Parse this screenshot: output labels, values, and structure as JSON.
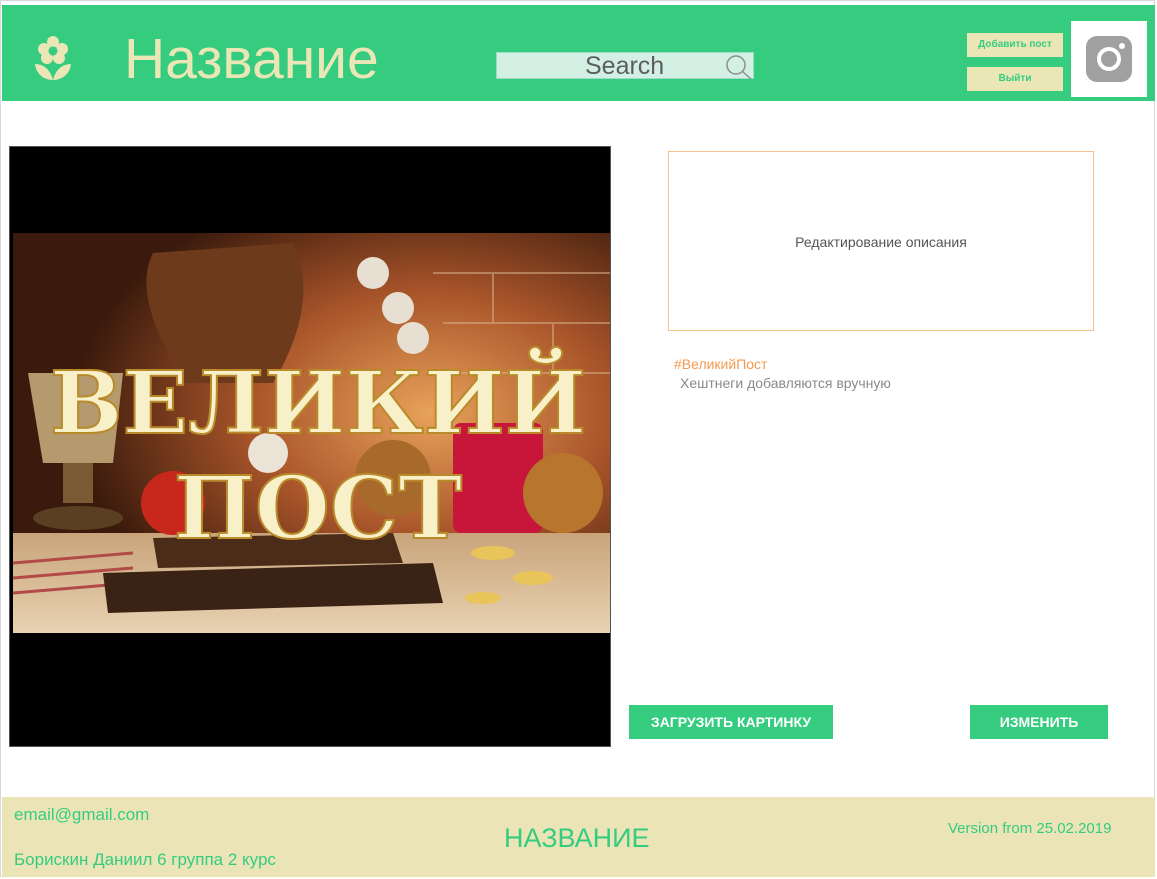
{
  "header": {
    "title": "Название",
    "search_placeholder": "Search",
    "add_post_label": "Добавить пост",
    "logout_label": "Выйти",
    "icons": [
      "flower-icon",
      "search-icon",
      "camera-icon"
    ]
  },
  "post": {
    "image_icon": "post-image",
    "description_placeholder": "Редактирование описания",
    "hashtag": "#ВеликийПост",
    "hashtag_hint": "Хештнеги добавляются вручную",
    "upload_label": "ЗАГРУЗИТЬ КАРТИНКУ",
    "edit_label": "ИЗМЕНИТЬ"
  },
  "footer": {
    "email": "email@gmail.com",
    "author": "Борискин Даниил  6 группа 2 курс",
    "title": "НАЗВАНИЕ",
    "version": "Version from 25.02.2019"
  },
  "colors": {
    "brand_green": "#35cc80",
    "cream": "#ebe6b6",
    "accent_orange": "#f39a52"
  }
}
